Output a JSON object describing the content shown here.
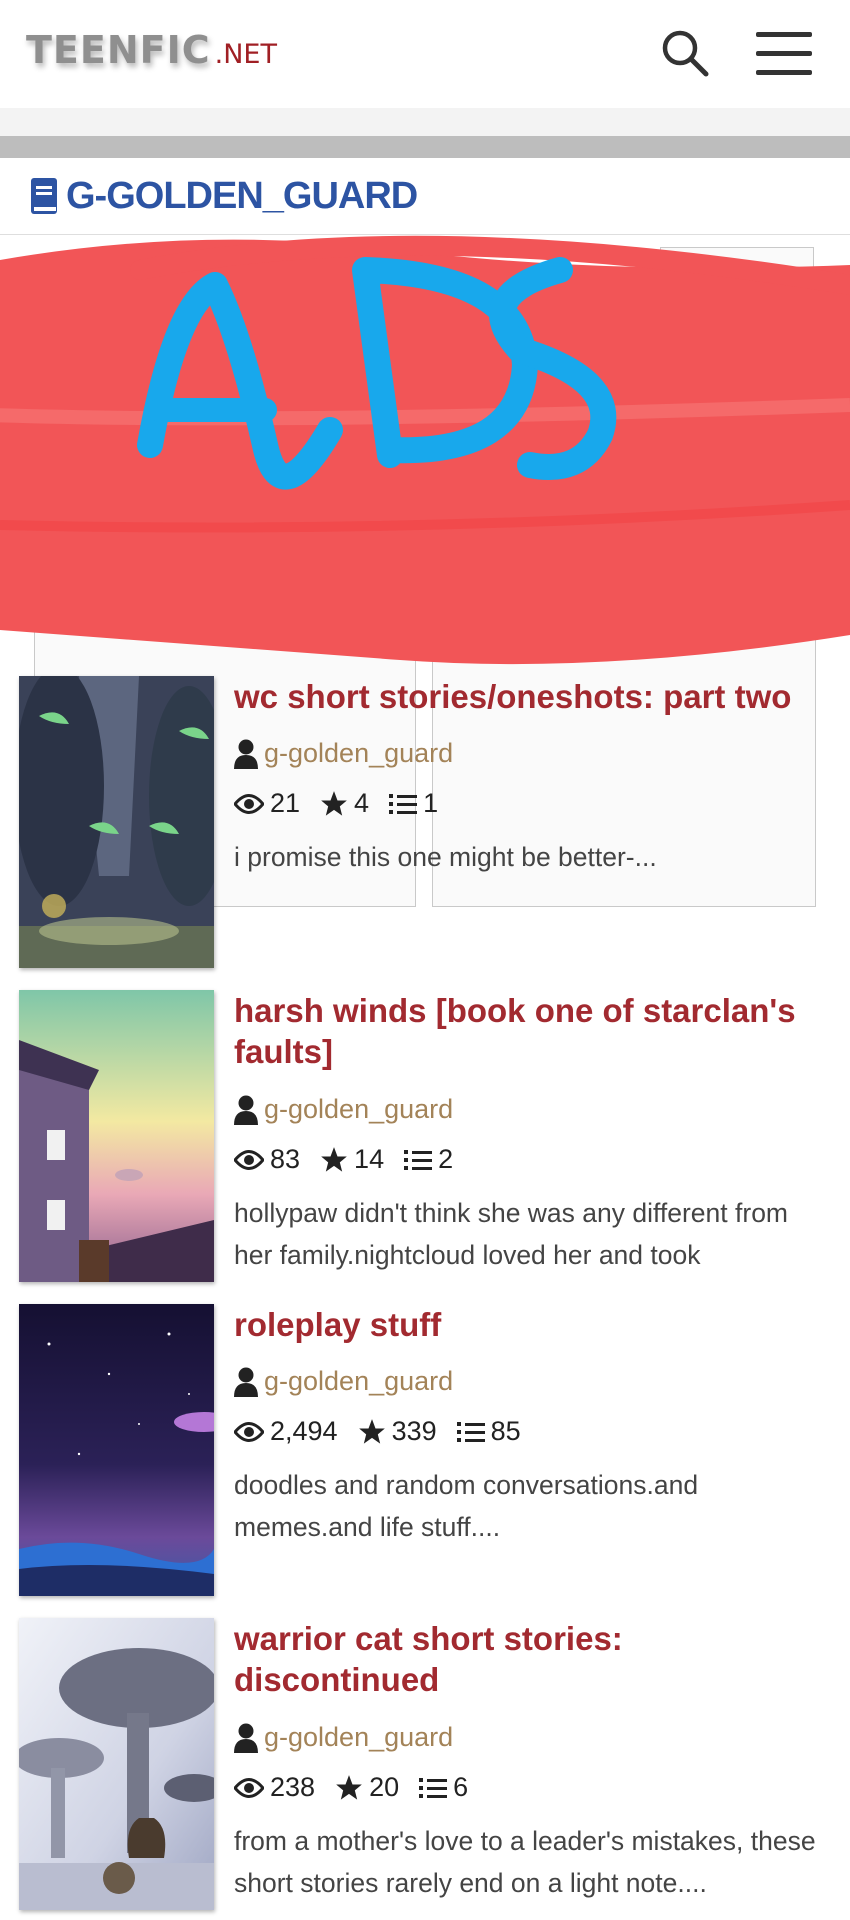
{
  "header": {
    "logo_main": "TEENFIC",
    "logo_suffix": ".NET"
  },
  "author": {
    "name": "G-GOLDEN_GUARD"
  },
  "ads_overlay": {
    "text": "ADS",
    "color": "#f25557",
    "text_color": "#18a8ec"
  },
  "stories": [
    {
      "title": "wc short stories/oneshots: part two",
      "author": "g-golden_guard",
      "views": "21",
      "votes": "4",
      "parts": "1",
      "description": "i promise this one might be better-..."
    },
    {
      "title": "harsh winds [book one of starclan's faults]",
      "author": "g-golden_guard",
      "views": "83",
      "votes": "14",
      "parts": "2",
      "description": "hollypaw didn't think she was any different from her family.nightcloud loved her and took"
    },
    {
      "title": "roleplay stuff",
      "author": "g-golden_guard",
      "views": "2,494",
      "votes": "339",
      "parts": "85",
      "description": "doodles and random conversations.and memes.and life stuff...."
    },
    {
      "title": "warrior cat short stories: discontinued",
      "author": "g-golden_guard",
      "views": "238",
      "votes": "20",
      "parts": "6",
      "description": "from a mother's love to a leader's mistakes, these short stories rarely end on a light note...."
    }
  ],
  "colors": {
    "title": "#a22a30",
    "author_link": "#a38358",
    "heading": "#2d54a3"
  }
}
